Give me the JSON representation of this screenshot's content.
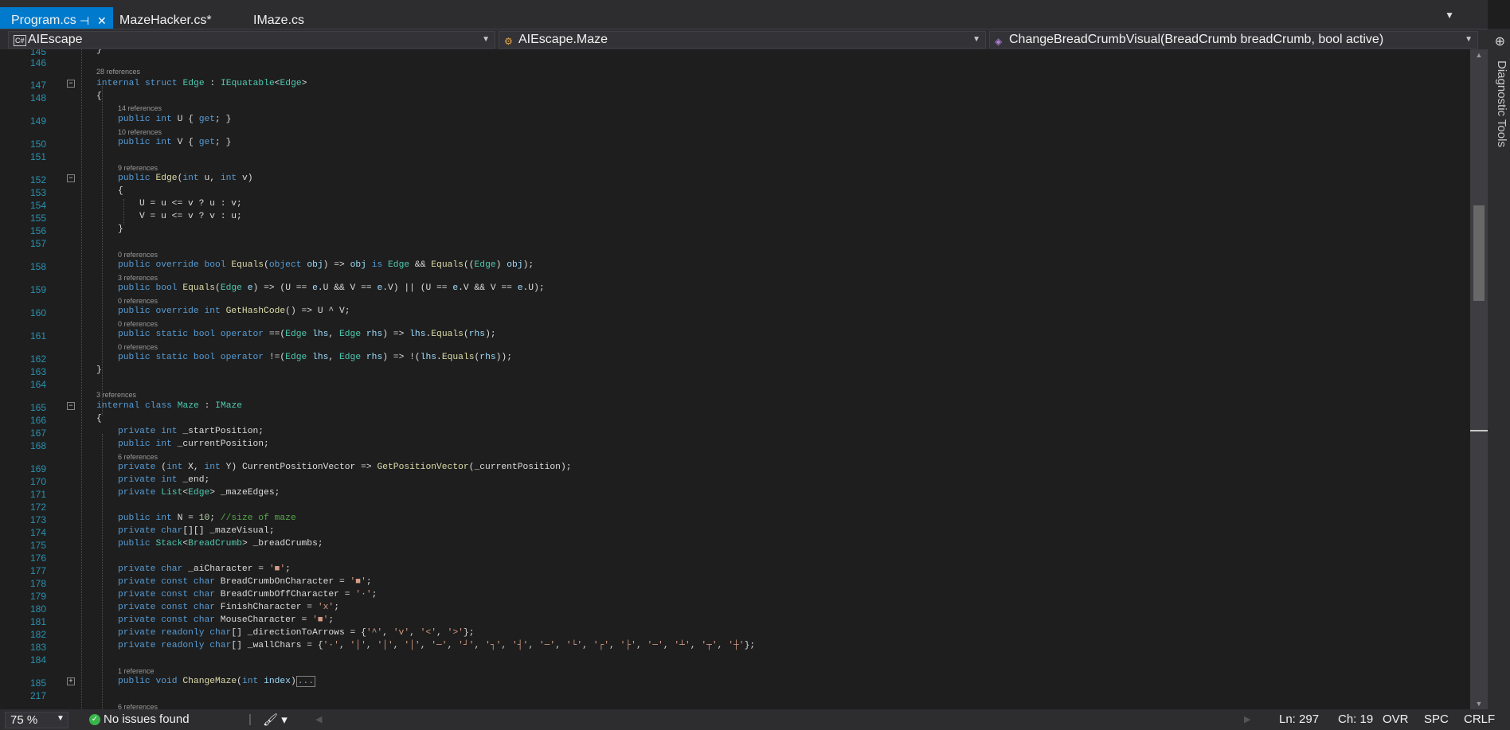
{
  "tabs": [
    {
      "label": "Program.cs",
      "active": true
    },
    {
      "label": "MazeHacker.cs*",
      "active": false
    },
    {
      "label": "IMaze.cs",
      "active": false
    }
  ],
  "nav": {
    "project": "AIEscape",
    "type": "AIEscape.Maze",
    "member": "ChangeBreadCrumbVisual(BreadCrumb breadCrumb, bool active)",
    "project_icon": "csharp-project-icon",
    "type_icon": "class-icon",
    "member_icon": "method-icon"
  },
  "side_tools": {
    "label": "Diagnostic Tools"
  },
  "lens": {
    "l147": "28 references",
    "l149": "14 references",
    "l150": "10 references",
    "l152": "9 references",
    "l158": "0 references",
    "l159": "3 references",
    "l160": "0 references",
    "l161": "0 references",
    "l162": "0 references",
    "l165": "3 references",
    "l169": "6 references",
    "l185": "1 reference",
    "l218": "6 references"
  },
  "line_numbers": [
    "145",
    "146",
    "147",
    "148",
    "149",
    "150",
    "151",
    "152",
    "153",
    "154",
    "155",
    "156",
    "157",
    "158",
    "159",
    "160",
    "161",
    "162",
    "163",
    "164",
    "165",
    "166",
    "167",
    "168",
    "169",
    "170",
    "171",
    "172",
    "173",
    "174",
    "175",
    "176",
    "177",
    "178",
    "179",
    "180",
    "181",
    "182",
    "183",
    "184",
    "185",
    "217"
  ],
  "code": {
    "l145": "}",
    "l148": "{",
    "l153": "{",
    "l156": "}",
    "l163": "}",
    "l166": "{",
    "l185_collapsed": "..."
  },
  "status": {
    "zoom": "75 %",
    "issues": "No issues found",
    "line": "Ln: 297",
    "col": "Ch: 19",
    "ovr": "OVR",
    "spc": "SPC",
    "eol": "CRLF"
  },
  "colors": {
    "accent": "#007acc",
    "keyword": "#569cd6",
    "type": "#4ec9b0",
    "method": "#dcdcaa",
    "string": "#d69d85",
    "comment": "#57a64a",
    "linenumber": "#2b91af",
    "background": "#1e1e1e"
  }
}
